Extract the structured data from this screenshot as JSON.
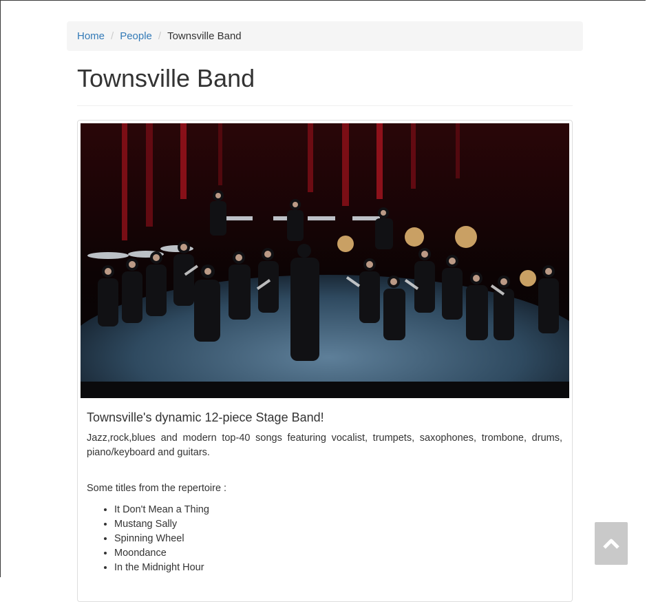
{
  "breadcrumb": {
    "items": [
      {
        "label": "Home"
      },
      {
        "label": "People"
      }
    ],
    "separator": "/",
    "current": "Townsville Band"
  },
  "page": {
    "title": "Townsville Band"
  },
  "media": {
    "subject": "band-photo"
  },
  "caption": {
    "heading": "Townsville's dynamic 12-piece Stage Band!",
    "description": "Jazz,rock,blues and modern top-40 songs featuring vocalist, trumpets, saxophones, trombone, drums, piano/keyboard and guitars.",
    "repertoire_intro": "Some titles from the repertoire :",
    "repertoire": [
      "It Don't Mean a Thing",
      "Mustang Sally",
      "Spinning Wheel",
      "Moondance",
      "In the Midnight Hour"
    ]
  },
  "scroll_top": {
    "icon": "chevron-up-icon"
  },
  "colors": {
    "link": "#337ab7",
    "breadcrumb_bg": "#f5f5f5",
    "scroll_button": "#c9c9c9"
  }
}
